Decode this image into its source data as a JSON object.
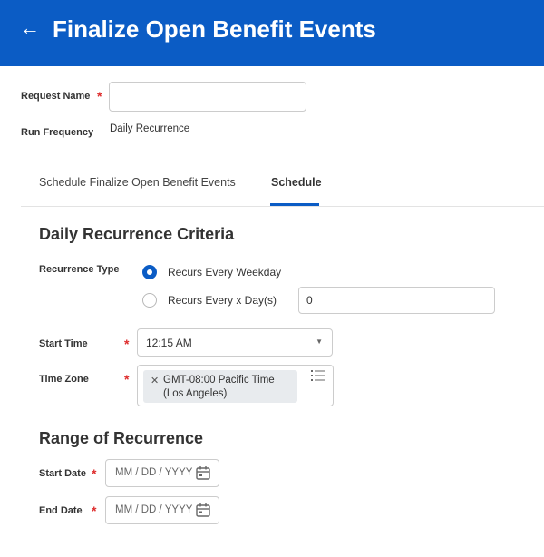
{
  "header": {
    "back_icon": "arrow-left-icon",
    "title": "Finalize Open Benefit Events",
    "background": "#0b5cc5"
  },
  "form": {
    "request_name_label": "Request Name",
    "request_name_value": "",
    "run_frequency_label": "Run Frequency",
    "run_frequency_value": "Daily Recurrence",
    "required_marker": "*"
  },
  "tabs": [
    {
      "label": "Schedule Finalize Open Benefit Events",
      "active": false
    },
    {
      "label": "Schedule",
      "active": true
    }
  ],
  "daily_criteria": {
    "heading": "Daily Recurrence Criteria",
    "recurrence_type_label": "Recurrence Type",
    "options": [
      {
        "label": "Recurs Every Weekday",
        "selected": true
      },
      {
        "label": "Recurs Every x Day(s)",
        "selected": false
      }
    ],
    "x_days_value": "0",
    "start_time_label": "Start Time",
    "start_time_value": "12:15 AM",
    "time_zone_label": "Time Zone",
    "time_zone_line1": "GMT-08:00 Pacific Time",
    "time_zone_line2": "(Los Angeles)"
  },
  "range": {
    "heading": "Range of Recurrence",
    "start_date_label": "Start Date",
    "end_date_label": "End Date",
    "date_placeholder": "MM / DD / YYYY",
    "calendar_icon": "calendar-icon"
  },
  "colors": {
    "accent": "#0b5cc5",
    "required": "#de2d2d"
  }
}
